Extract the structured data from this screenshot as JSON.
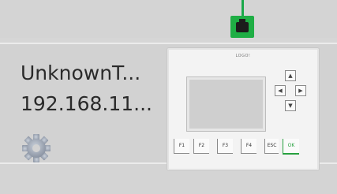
{
  "device": {
    "name": "UnknownT...",
    "ip": "192.168.11...",
    "brand": "LOGO!"
  },
  "keys": {
    "f1": "F1",
    "f2": "F2",
    "f3": "F3",
    "f4": "F4",
    "esc": "ESC",
    "ok": "OK"
  },
  "dpad": {
    "up": "▲",
    "down": "▼",
    "left": "◀",
    "right": "▶"
  },
  "colors": {
    "connection": "#1fae45",
    "background": "#d6d6d6"
  },
  "icons": {
    "connection": "network-port-icon",
    "settings": "gear-icon"
  }
}
